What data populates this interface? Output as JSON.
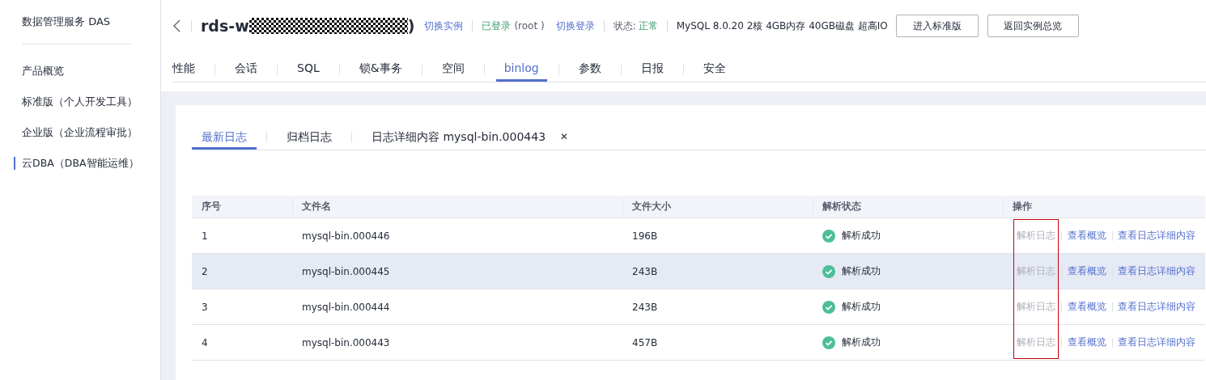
{
  "sidebar": {
    "title": "数据管理服务 DAS",
    "items": [
      {
        "label": "产品概览",
        "selected": false
      },
      {
        "label": "标准版（个人开发工具）",
        "selected": false
      },
      {
        "label": "企业版（企业流程审批）",
        "selected": false
      },
      {
        "label": "云DBA（DBA智能运维）",
        "selected": true
      }
    ]
  },
  "header": {
    "instance": {
      "prefix": "rds-w",
      "suffix": ")",
      "redacted": true
    },
    "switch_instance": "切换实例",
    "login": {
      "status": "已登录",
      "user": "(root )"
    },
    "switch_login": "切换登录",
    "state": {
      "label": "状态:",
      "value": "正常"
    },
    "specs": "MySQL 8.0.20 2核 4GB内存 40GB磁盘 超高IO",
    "buttons": [
      "进入标准版",
      "返回实例总览"
    ]
  },
  "tabs": [
    {
      "label": "性能",
      "selected": false
    },
    {
      "label": "会话",
      "selected": false
    },
    {
      "label": "SQL",
      "selected": false
    },
    {
      "label": "锁&事务",
      "selected": false
    },
    {
      "label": "空间",
      "selected": false
    },
    {
      "label": "binlog",
      "selected": true
    },
    {
      "label": "参数",
      "selected": false
    },
    {
      "label": "日报",
      "selected": false
    },
    {
      "label": "安全",
      "selected": false
    }
  ],
  "subtabs": [
    {
      "label": "最新日志",
      "selected": true
    },
    {
      "label": "归档日志",
      "selected": false
    },
    {
      "label": "日志详细内容 mysql-bin.000443",
      "selected": false,
      "close": "✕"
    }
  ],
  "table": {
    "first_action_framed": true,
    "columns": [
      "序号",
      "文件名",
      "文件大小",
      "解析状态",
      "操作"
    ],
    "rows": [
      {
        "number": "1",
        "file": "mysql-bin.000446",
        "size": "196B",
        "status": "解析成功",
        "ok": true,
        "hovered": false,
        "actions": [
          {
            "label": "解析日志",
            "disabled": true
          },
          {
            "label": "查看概览",
            "disabled": false
          },
          {
            "label": "查看日志详细内容",
            "disabled": false
          }
        ]
      },
      {
        "number": "2",
        "file": "mysql-bin.000445",
        "size": "243B",
        "status": "解析成功",
        "ok": true,
        "hovered": true,
        "actions": [
          {
            "label": "解析日志",
            "disabled": true
          },
          {
            "label": "查看概览",
            "disabled": false
          },
          {
            "label": "查看日志详细内容",
            "disabled": false
          }
        ]
      },
      {
        "number": "3",
        "file": "mysql-bin.000444",
        "size": "243B",
        "status": "解析成功",
        "ok": true,
        "hovered": false,
        "actions": [
          {
            "label": "解析日志",
            "disabled": true
          },
          {
            "label": "查看概览",
            "disabled": false
          },
          {
            "label": "查看日志详细内容",
            "disabled": false
          }
        ]
      },
      {
        "number": "4",
        "file": "mysql-bin.000443",
        "size": "457B",
        "status": "解析成功",
        "ok": true,
        "hovered": false,
        "actions": [
          {
            "label": "解析日志",
            "disabled": true
          },
          {
            "label": "查看概览",
            "disabled": false
          },
          {
            "label": "查看日志详细内容",
            "disabled": false
          }
        ]
      }
    ]
  }
}
